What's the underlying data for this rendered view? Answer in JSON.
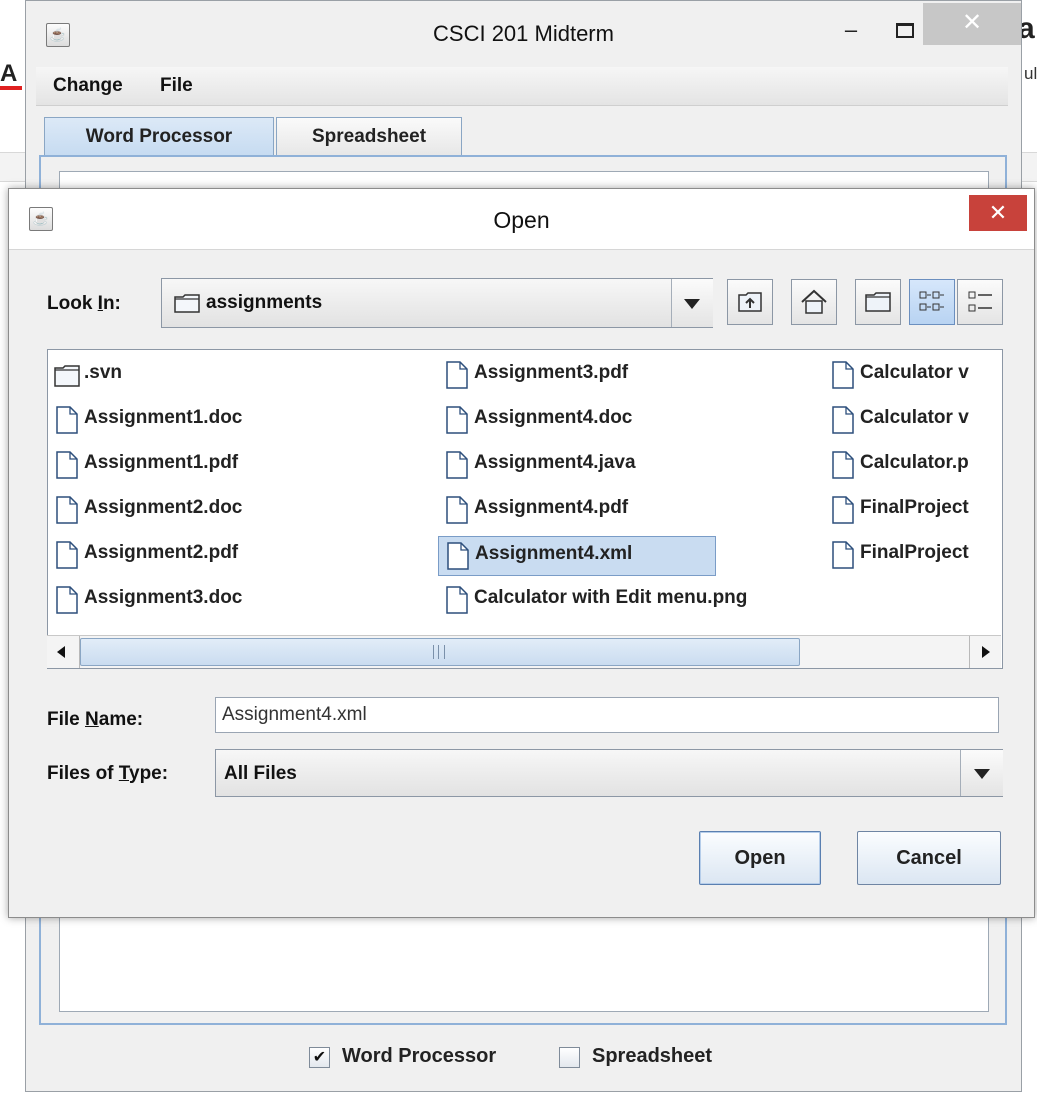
{
  "background": {
    "letter_left": "A",
    "letter_right": "a",
    "letter_right2": "ul"
  },
  "main_window": {
    "title": "CSCI 201 Midterm",
    "minimize_glyph": "–",
    "close_glyph": "✕",
    "menu": [
      "Change",
      "File"
    ],
    "tabs": [
      {
        "label": "Word Processor",
        "selected": true
      },
      {
        "label": "Spreadsheet",
        "selected": false
      }
    ],
    "checkboxes": [
      {
        "label": "Word Processor",
        "checked": true
      },
      {
        "label": "Spreadsheet",
        "checked": false
      }
    ],
    "check_glyph": "✔"
  },
  "open_dialog": {
    "title": "Open",
    "close_glyph": "✕",
    "look_in": {
      "label_pre": "Look ",
      "label_mnemonic": "I",
      "label_post": "n:",
      "value": "assignments"
    },
    "toolbar_icons": [
      "up-folder-icon",
      "home-icon",
      "new-folder-icon",
      "list-view-icon",
      "details-view-icon"
    ],
    "files": [
      [
        {
          "name": ".svn",
          "kind": "folder"
        },
        {
          "name": "Assignment1.doc",
          "kind": "file"
        },
        {
          "name": "Assignment1.pdf",
          "kind": "file"
        },
        {
          "name": "Assignment2.doc",
          "kind": "file"
        },
        {
          "name": "Assignment2.pdf",
          "kind": "file"
        },
        {
          "name": "Assignment3.doc",
          "kind": "file"
        }
      ],
      [
        {
          "name": "Assignment3.pdf",
          "kind": "file"
        },
        {
          "name": "Assignment4.doc",
          "kind": "file"
        },
        {
          "name": "Assignment4.java",
          "kind": "file"
        },
        {
          "name": "Assignment4.pdf",
          "kind": "file"
        },
        {
          "name": "Assignment4.xml",
          "kind": "file",
          "selected": true
        },
        {
          "name": "Calculator with Edit menu.png",
          "kind": "file"
        }
      ],
      [
        {
          "name": "Calculator v",
          "kind": "file"
        },
        {
          "name": "Calculator v",
          "kind": "file"
        },
        {
          "name": "Calculator.p",
          "kind": "file"
        },
        {
          "name": "FinalProject",
          "kind": "file"
        },
        {
          "name": "FinalProject",
          "kind": "file"
        }
      ]
    ],
    "file_name": {
      "label_pre": "File ",
      "label_mnemonic": "N",
      "label_post": "ame:",
      "value": "Assignment4.xml"
    },
    "file_type": {
      "label_pre": "Files of ",
      "label_mnemonic": "T",
      "label_post": "ype:",
      "value": "All Files"
    },
    "open_label": "Open",
    "cancel_label": "Cancel"
  }
}
